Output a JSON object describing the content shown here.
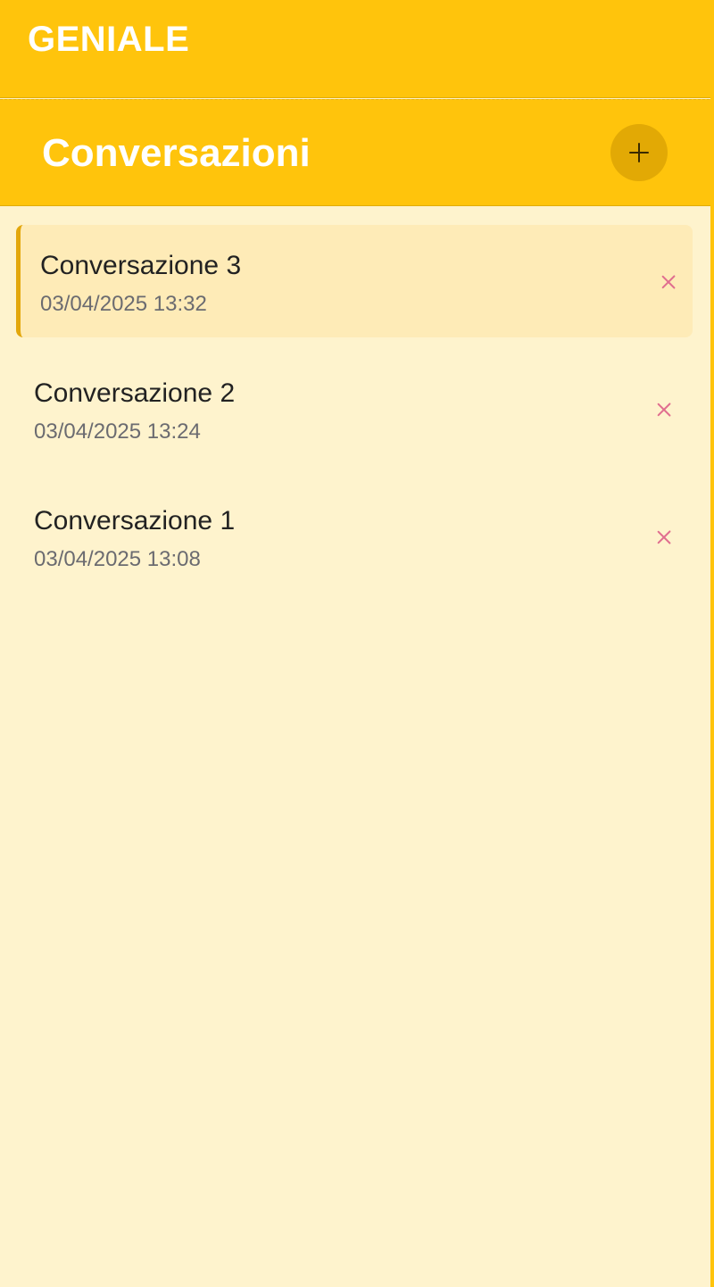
{
  "app": {
    "title": "GENIALE"
  },
  "panel": {
    "title": "Conversazioni",
    "new_button_icon": "plus-icon"
  },
  "conversations": [
    {
      "name": "Conversazione 3",
      "date": "03/04/2025 13:32",
      "active": true,
      "delete_icon": "close-icon"
    },
    {
      "name": "Conversazione 2",
      "date": "03/04/2025 13:24",
      "active": false,
      "delete_icon": "close-icon"
    },
    {
      "name": "Conversazione 1",
      "date": "03/04/2025 13:08",
      "active": false,
      "delete_icon": "close-icon"
    }
  ],
  "colors": {
    "header_yellow": "#FFC40C",
    "background": "#FEF3CD",
    "active_item_bg": "#FEEBB7",
    "active_border": "#E3A70B",
    "new_button_bg": "#E2A905",
    "delete_icon": "#E06E8F",
    "date_text": "#6B6B70"
  }
}
